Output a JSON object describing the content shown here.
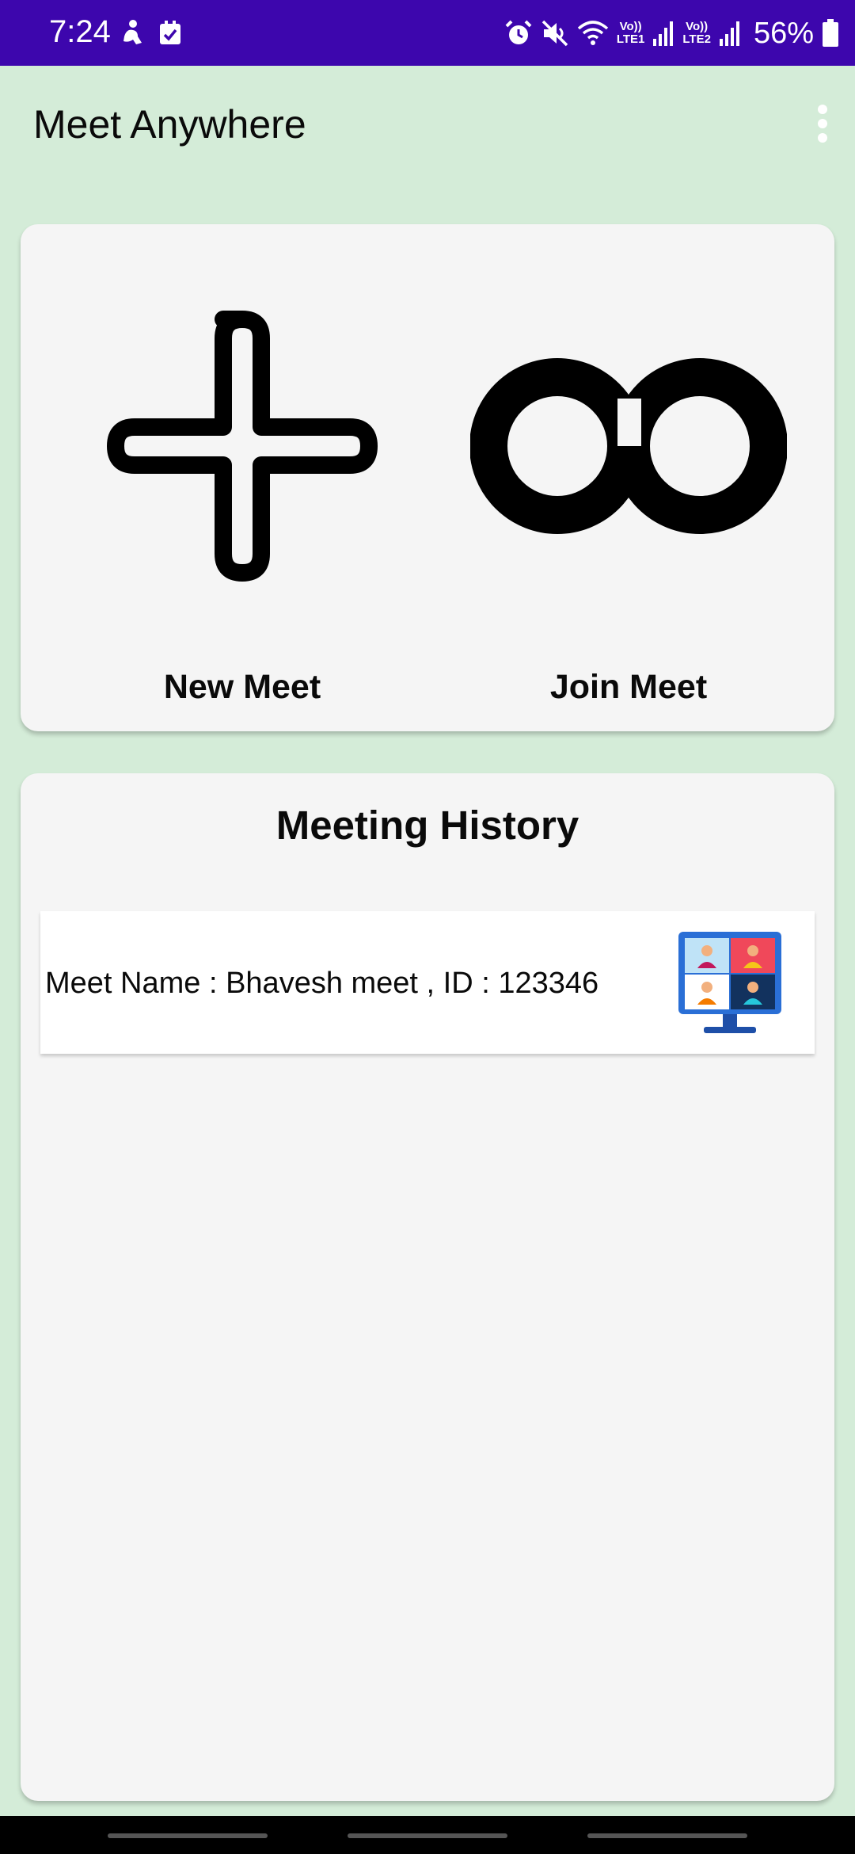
{
  "status_bar": {
    "time": "7:24",
    "sim1_label": "Vo))\nLTE1",
    "sim2_label": "Vo))\nLTE2",
    "battery": "56%",
    "icons": [
      "accessibility-icon",
      "checkbox-icon",
      "alarm-icon",
      "mute-icon",
      "wifi-icon",
      "signal-icon",
      "battery-icon"
    ]
  },
  "app_bar": {
    "title": "Meet Anywhere"
  },
  "actions": {
    "new_meet_label": "New Meet",
    "join_meet_label": "Join Meet"
  },
  "history": {
    "title": "Meeting History",
    "items": [
      {
        "text": "Meet Name : Bhavesh meet , ID : 123346",
        "icon": "video-conference-icon"
      }
    ]
  },
  "colors": {
    "status_bar": "#3d06ad",
    "background": "#d4ecd8",
    "card": "#f5f5f5"
  }
}
